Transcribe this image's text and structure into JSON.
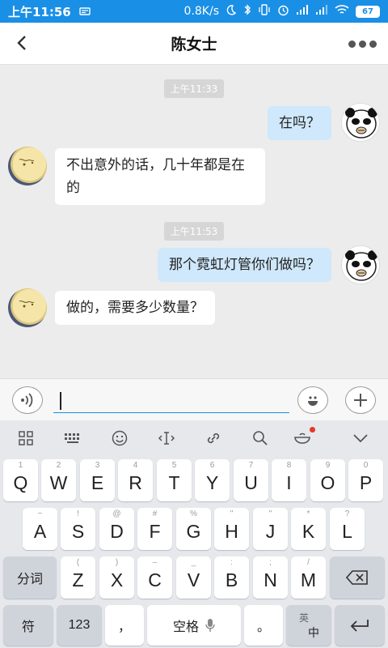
{
  "status_bar": {
    "time": "上午11:56",
    "net_speed": "0.8K/s",
    "battery": "67"
  },
  "header": {
    "back_icon": "chevron-left-icon",
    "title": "陈女士",
    "more_icon": "more-dots-icon"
  },
  "messages": [
    {
      "type": "time",
      "text": "上午11:33"
    },
    {
      "type": "out",
      "text": "在吗？",
      "avatar": "panda-avatar"
    },
    {
      "type": "in",
      "text": "不出意外的话，几十年都是在的",
      "avatar": "moon-avatar"
    },
    {
      "type": "time",
      "text": "上午11:53"
    },
    {
      "type": "out",
      "text": "那个霓虹灯管你们做吗？",
      "avatar": "panda-avatar"
    },
    {
      "type": "in",
      "text": "做的，需要多少数量？",
      "avatar": "moon-avatar"
    }
  ],
  "input_bar": {
    "voice_icon": "voice-icon",
    "value": "",
    "emoji_icon": "emoji-icon",
    "plus_icon": "plus-icon"
  },
  "keyboard": {
    "toolbar": [
      "grid-icon",
      "keyboard-icon",
      "emoji-icon",
      "cursor-icon",
      "link-icon",
      "search-icon",
      "sticker-icon",
      "collapse-icon"
    ],
    "row1": [
      {
        "hint": "1",
        "key": "Q"
      },
      {
        "hint": "2",
        "key": "W"
      },
      {
        "hint": "3",
        "key": "E"
      },
      {
        "hint": "4",
        "key": "R"
      },
      {
        "hint": "5",
        "key": "T"
      },
      {
        "hint": "6",
        "key": "Y"
      },
      {
        "hint": "7",
        "key": "U"
      },
      {
        "hint": "8",
        "key": "I"
      },
      {
        "hint": "9",
        "key": "O"
      },
      {
        "hint": "0",
        "key": "P"
      }
    ],
    "row2": [
      {
        "hint": "~",
        "key": "A"
      },
      {
        "hint": "!",
        "key": "S"
      },
      {
        "hint": "@",
        "key": "D"
      },
      {
        "hint": "#",
        "key": "F"
      },
      {
        "hint": "%",
        "key": "G"
      },
      {
        "hint": "\"",
        "key": "H"
      },
      {
        "hint": "\"",
        "key": "J"
      },
      {
        "hint": "*",
        "key": "K"
      },
      {
        "hint": "?",
        "key": "L"
      }
    ],
    "row3": [
      {
        "hint": "(",
        "key": "Z"
      },
      {
        "hint": ")",
        "key": "X"
      },
      {
        "hint": "–",
        "key": "C"
      },
      {
        "hint": "_",
        "key": "V"
      },
      {
        "hint": ":",
        "key": "B"
      },
      {
        "hint": ";",
        "key": "N"
      },
      {
        "hint": "/",
        "key": "M"
      }
    ],
    "fenci": "分词",
    "delete_icon": "backspace-icon",
    "fu": "符",
    "num": "123",
    "comma": "，",
    "space": "空格",
    "mic_icon": "mic-icon",
    "period": "。",
    "lang_en": "英",
    "lang_zh": "中",
    "enter_icon": "enter-icon"
  }
}
